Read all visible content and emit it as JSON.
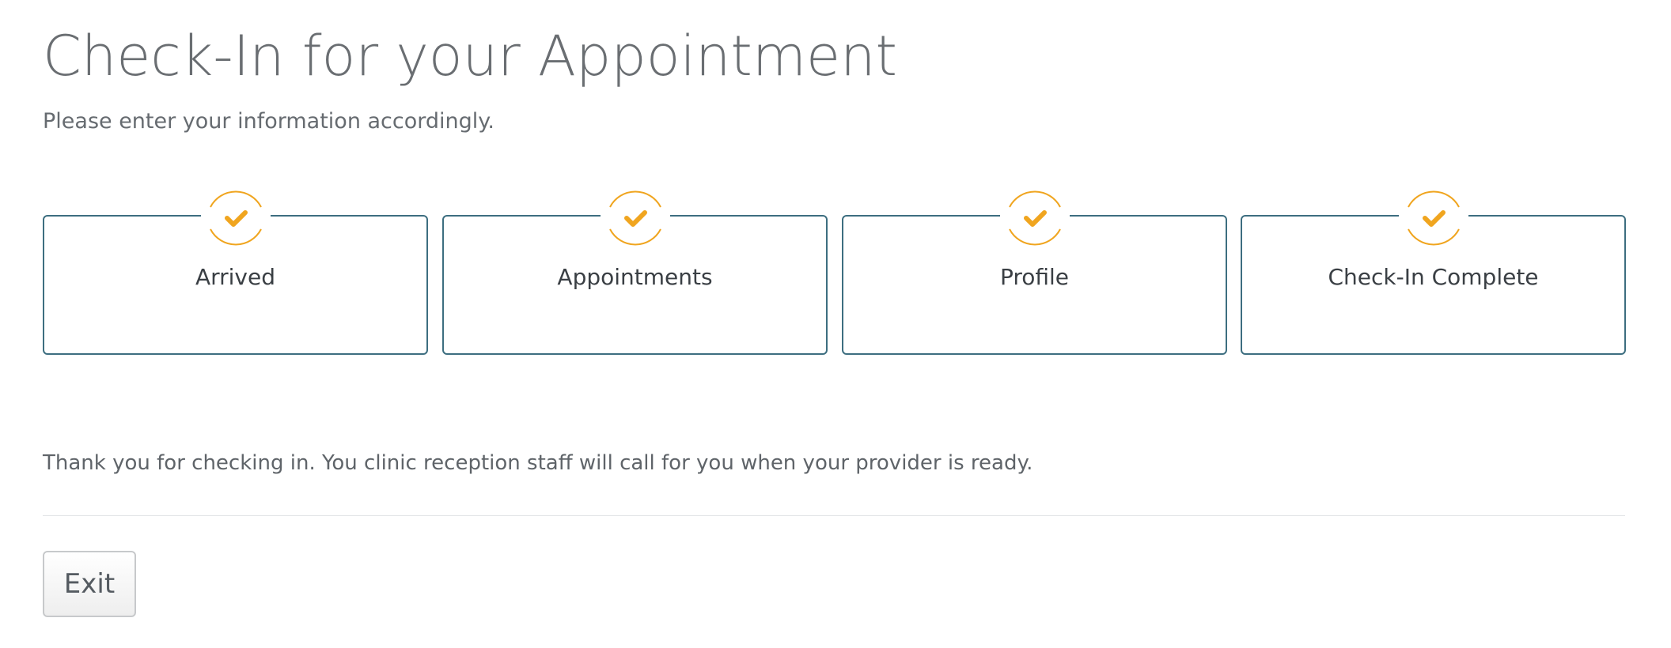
{
  "header": {
    "title": "Check-In for your Appointment",
    "subtitle": "Please enter your information accordingly."
  },
  "steps": [
    {
      "label": "Arrived",
      "icon": "checkmark-icon",
      "status": "complete"
    },
    {
      "label": "Appointments",
      "icon": "checkmark-icon",
      "status": "complete"
    },
    {
      "label": "Profile",
      "icon": "checkmark-icon",
      "status": "complete"
    },
    {
      "label": "Check-In Complete",
      "icon": "checkmark-icon",
      "status": "complete"
    }
  ],
  "message": "Thank you for checking in. You clinic reception staff will call for you when your provider is ready.",
  "actions": {
    "exit_label": "Exit"
  },
  "colors": {
    "step_border": "#3d6e80",
    "check_accent": "#f0a51f"
  }
}
